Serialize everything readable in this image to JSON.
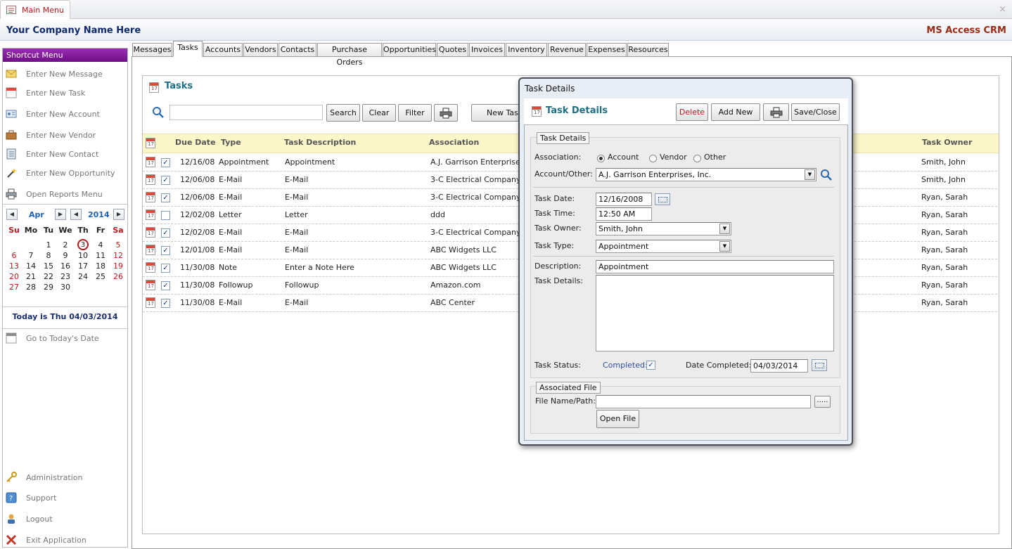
{
  "window": {
    "tab_title": "Main Menu",
    "close_glyph": "×"
  },
  "banner": {
    "company": "Your Company Name Here",
    "product": "MS Access CRM"
  },
  "sidebar": {
    "header": "Shortcut Menu",
    "items": [
      {
        "label": "Enter New Message",
        "icon": "envelope-icon"
      },
      {
        "label": "Enter New Task",
        "icon": "calendar-icon"
      },
      {
        "label": "Enter New Account",
        "icon": "id-card-icon"
      },
      {
        "label": "Enter New Vendor",
        "icon": "briefcase-icon"
      },
      {
        "label": "Enter New Contact",
        "icon": "address-book-icon"
      },
      {
        "label": "Enter New Opportunity",
        "icon": "magic-wand-icon"
      },
      {
        "label": "Open Reports Menu",
        "icon": "printer-icon"
      }
    ],
    "calendar": {
      "month": "Apr",
      "year": "2014",
      "weekdays": [
        "Su",
        "Mo",
        "Tu",
        "We",
        "Th",
        "Fr",
        "Sa"
      ],
      "weeks": [
        [
          "",
          "",
          "1",
          "2",
          "3",
          "4",
          "5"
        ],
        [
          "6",
          "7",
          "8",
          "9",
          "10",
          "11",
          "12"
        ],
        [
          "13",
          "14",
          "15",
          "16",
          "17",
          "18",
          "19"
        ],
        [
          "20",
          "21",
          "22",
          "23",
          "24",
          "25",
          "26"
        ],
        [
          "27",
          "28",
          "29",
          "30",
          "",
          "",
          ""
        ]
      ],
      "today_day": "3"
    },
    "today_text": "Today is Thu 04/03/2014",
    "goto_today": "Go to Today's Date",
    "bottom_items": [
      {
        "label": "Administration",
        "icon": "key-icon"
      },
      {
        "label": "Support",
        "icon": "help-icon"
      },
      {
        "label": "Logout",
        "icon": "user-icon"
      },
      {
        "label": "Exit Application",
        "icon": "exit-icon"
      }
    ]
  },
  "tabs": [
    "Messages",
    "Tasks",
    "Accounts",
    "Vendors",
    "Contacts",
    "Purchase Orders",
    "Opportunities",
    "Quotes",
    "Invoices",
    "Inventory",
    "Revenue",
    "Expenses",
    "Resources"
  ],
  "active_tab": "Tasks",
  "tasks": {
    "title": "Tasks",
    "search_value": "",
    "buttons": {
      "search": "Search",
      "clear": "Clear",
      "filter": "Filter",
      "new_task": "New Task"
    },
    "columns": {
      "due_date": "Due Date",
      "type": "Type",
      "description": "Task Description",
      "association": "Association",
      "owner": "Task Owner"
    },
    "rows": [
      {
        "checked": true,
        "due": "12/16/08",
        "type": "Appointment",
        "desc": "Appointment",
        "assoc": "A.J. Garrison Enterprises,",
        "owner": "Smith, John"
      },
      {
        "checked": true,
        "due": "12/06/08",
        "type": "E-Mail",
        "desc": "E-Mail",
        "assoc": "3-C Electrical Company",
        "owner": "Smith, John"
      },
      {
        "checked": true,
        "due": "12/06/08",
        "type": "E-Mail",
        "desc": "E-Mail",
        "assoc": "3-C Electrical Company",
        "owner": "Ryan, Sarah"
      },
      {
        "checked": false,
        "due": "12/02/08",
        "type": "Letter",
        "desc": "Letter",
        "assoc": "ddd",
        "owner": "Ryan, Sarah"
      },
      {
        "checked": true,
        "due": "12/02/08",
        "type": "E-Mail",
        "desc": "E-Mail",
        "assoc": "3-C Electrical Company",
        "owner": "Ryan, Sarah"
      },
      {
        "checked": true,
        "due": "12/01/08",
        "type": "E-Mail",
        "desc": "E-Mail",
        "assoc": "ABC Widgets LLC",
        "owner": "Ryan, Sarah"
      },
      {
        "checked": true,
        "due": "11/30/08",
        "type": "Note",
        "desc": "Enter a Note Here",
        "assoc": "ABC Widgets LLC",
        "owner": "Ryan, Sarah"
      },
      {
        "checked": true,
        "due": "11/30/08",
        "type": "Followup",
        "desc": "Followup",
        "assoc": "Amazon.com",
        "owner": "Ryan, Sarah"
      },
      {
        "checked": true,
        "due": "11/30/08",
        "type": "E-Mail",
        "desc": "E-Mail",
        "assoc": "ABC Center",
        "owner": "Ryan, Sarah"
      }
    ]
  },
  "dialog": {
    "window_title": "Task Details",
    "title": "Task Details",
    "buttons": {
      "delete": "Delete",
      "add_new": "Add New",
      "save_close": "Save/Close",
      "open_file": "Open File",
      "browse": "....."
    },
    "section_task": "Task Details",
    "labels": {
      "association": "Association:",
      "account_other": "Account/Other:",
      "task_date": "Task Date:",
      "task_time": "Task Time:",
      "task_owner": "Task Owner:",
      "task_type": "Task Type:",
      "description": "Description:",
      "task_details": "Task Details:",
      "task_status": "Task Status:",
      "completed": "Completed:",
      "date_completed": "Date Completed:",
      "file_name": "File Name/Path:"
    },
    "association_options": [
      "Account",
      "Vendor",
      "Other"
    ],
    "association_selected": "Account",
    "values": {
      "account_other": "A.J. Garrison Enterprises, Inc.",
      "task_date": "12/16/2008",
      "task_time": "12:50 AM",
      "task_owner": "Smith, John",
      "task_type": "Appointment",
      "description": "Appointment",
      "task_details": "",
      "completed": true,
      "date_completed": "04/03/2014",
      "file_path": ""
    },
    "section_file": "Associated File"
  }
}
